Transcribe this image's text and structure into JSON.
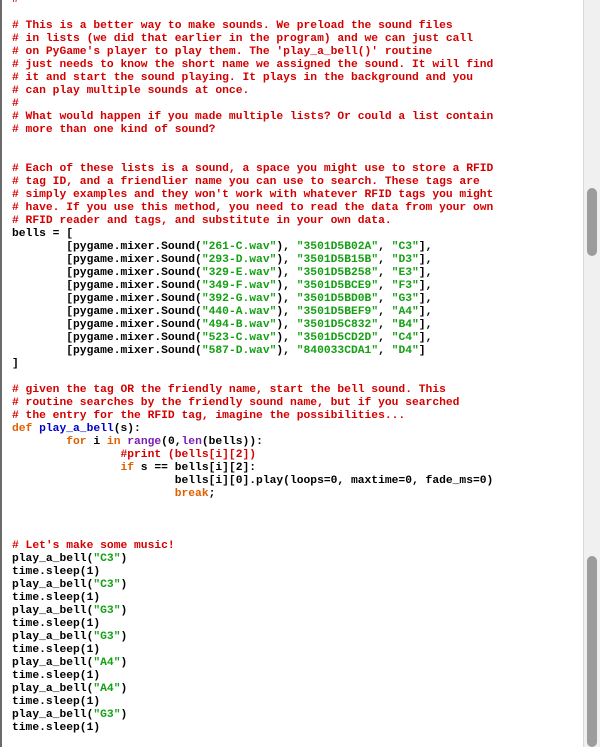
{
  "colors": {
    "comment": "#d40000",
    "string": "#14a014",
    "keyword": "#e06000",
    "builtin": "#7a1fb0",
    "function_name": "#0000c8",
    "text": "#000000"
  },
  "editor": {
    "lines": [
      [
        {
          "t": "cm",
          "v": "# ------------------------------------------------------------"
        }
      ],
      [],
      [
        {
          "t": "cm",
          "v": "# This is a better way to make sounds. We preload the sound files"
        }
      ],
      [
        {
          "t": "cm",
          "v": "# in lists (we did that earlier in the program) and we can just call"
        }
      ],
      [
        {
          "t": "cm",
          "v": "# on PyGame's player to play them. The 'play_a_bell()' routine"
        }
      ],
      [
        {
          "t": "cm",
          "v": "# just needs to know the short name we assigned the sound. It will find"
        }
      ],
      [
        {
          "t": "cm",
          "v": "# it and start the sound playing. It plays in the background and you"
        }
      ],
      [
        {
          "t": "cm",
          "v": "# can play multiple sounds at once."
        }
      ],
      [
        {
          "t": "cm",
          "v": "#"
        }
      ],
      [
        {
          "t": "cm",
          "v": "# What would happen if you made multiple lists? Or could a list contain"
        }
      ],
      [
        {
          "t": "cm",
          "v": "# more than one kind of sound?"
        }
      ],
      [],
      [],
      [
        {
          "t": "cm",
          "v": "# Each of these lists is a sound, a space you might use to store a RFID"
        }
      ],
      [
        {
          "t": "cm",
          "v": "# tag ID, and a friendlier name you can use to search. These tags are"
        }
      ],
      [
        {
          "t": "cm",
          "v": "# simply examples and they won't work with whatever RFID tags you might"
        }
      ],
      [
        {
          "t": "cm",
          "v": "# have. If you use this method, you need to read the data from your own"
        }
      ],
      [
        {
          "t": "cm",
          "v": "# RFID reader and tags, and substitute in your own data."
        }
      ],
      [
        {
          "t": "pl",
          "v": "bells = ["
        }
      ],
      [
        {
          "t": "pl",
          "v": "        [pygame.mixer.Sound("
        },
        {
          "t": "str",
          "v": "\"261-C.wav\""
        },
        {
          "t": "pl",
          "v": "), "
        },
        {
          "t": "str",
          "v": "\"3501D5B02A\""
        },
        {
          "t": "pl",
          "v": ", "
        },
        {
          "t": "str",
          "v": "\"C3\""
        },
        {
          "t": "pl",
          "v": "],"
        }
      ],
      [
        {
          "t": "pl",
          "v": "        [pygame.mixer.Sound("
        },
        {
          "t": "str",
          "v": "\"293-D.wav\""
        },
        {
          "t": "pl",
          "v": "), "
        },
        {
          "t": "str",
          "v": "\"3501D5B15B\""
        },
        {
          "t": "pl",
          "v": ", "
        },
        {
          "t": "str",
          "v": "\"D3\""
        },
        {
          "t": "pl",
          "v": "],"
        }
      ],
      [
        {
          "t": "pl",
          "v": "        [pygame.mixer.Sound("
        },
        {
          "t": "str",
          "v": "\"329-E.wav\""
        },
        {
          "t": "pl",
          "v": "), "
        },
        {
          "t": "str",
          "v": "\"3501D5B258\""
        },
        {
          "t": "pl",
          "v": ", "
        },
        {
          "t": "str",
          "v": "\"E3\""
        },
        {
          "t": "pl",
          "v": "],"
        }
      ],
      [
        {
          "t": "pl",
          "v": "        [pygame.mixer.Sound("
        },
        {
          "t": "str",
          "v": "\"349-F.wav\""
        },
        {
          "t": "pl",
          "v": "), "
        },
        {
          "t": "str",
          "v": "\"3501D5BCE9\""
        },
        {
          "t": "pl",
          "v": ", "
        },
        {
          "t": "str",
          "v": "\"F3\""
        },
        {
          "t": "pl",
          "v": "],"
        }
      ],
      [
        {
          "t": "pl",
          "v": "        [pygame.mixer.Sound("
        },
        {
          "t": "str",
          "v": "\"392-G.wav\""
        },
        {
          "t": "pl",
          "v": "), "
        },
        {
          "t": "str",
          "v": "\"3501D5BD0B\""
        },
        {
          "t": "pl",
          "v": ", "
        },
        {
          "t": "str",
          "v": "\"G3\""
        },
        {
          "t": "pl",
          "v": "],"
        }
      ],
      [
        {
          "t": "pl",
          "v": "        [pygame.mixer.Sound("
        },
        {
          "t": "str",
          "v": "\"440-A.wav\""
        },
        {
          "t": "pl",
          "v": "), "
        },
        {
          "t": "str",
          "v": "\"3501D5BEF9\""
        },
        {
          "t": "pl",
          "v": ", "
        },
        {
          "t": "str",
          "v": "\"A4\""
        },
        {
          "t": "pl",
          "v": "],"
        }
      ],
      [
        {
          "t": "pl",
          "v": "        [pygame.mixer.Sound("
        },
        {
          "t": "str",
          "v": "\"494-B.wav\""
        },
        {
          "t": "pl",
          "v": "), "
        },
        {
          "t": "str",
          "v": "\"3501D5C832\""
        },
        {
          "t": "pl",
          "v": ", "
        },
        {
          "t": "str",
          "v": "\"B4\""
        },
        {
          "t": "pl",
          "v": "],"
        }
      ],
      [
        {
          "t": "pl",
          "v": "        [pygame.mixer.Sound("
        },
        {
          "t": "str",
          "v": "\"523-C.wav\""
        },
        {
          "t": "pl",
          "v": "), "
        },
        {
          "t": "str",
          "v": "\"3501D5CD2D\""
        },
        {
          "t": "pl",
          "v": ", "
        },
        {
          "t": "str",
          "v": "\"C4\""
        },
        {
          "t": "pl",
          "v": "],"
        }
      ],
      [
        {
          "t": "pl",
          "v": "        [pygame.mixer.Sound("
        },
        {
          "t": "str",
          "v": "\"587-D.wav\""
        },
        {
          "t": "pl",
          "v": "), "
        },
        {
          "t": "str",
          "v": "\"840033CDA1\""
        },
        {
          "t": "pl",
          "v": ", "
        },
        {
          "t": "str",
          "v": "\"D4\""
        },
        {
          "t": "pl",
          "v": "]"
        }
      ],
      [
        {
          "t": "pl",
          "v": "]"
        }
      ],
      [],
      [
        {
          "t": "cm",
          "v": "# given the tag OR the friendly name, start the bell sound. This"
        }
      ],
      [
        {
          "t": "cm",
          "v": "# routine searches by the friendly sound name, but if you searched"
        }
      ],
      [
        {
          "t": "cm",
          "v": "# the entry for the RFID tag, imagine the possibilities..."
        }
      ],
      [
        {
          "t": "kw",
          "v": "def"
        },
        {
          "t": "pl",
          "v": " "
        },
        {
          "t": "fn",
          "v": "play_a_bell"
        },
        {
          "t": "pl",
          "v": "(s):"
        }
      ],
      [
        {
          "t": "pl",
          "v": "        "
        },
        {
          "t": "kw",
          "v": "for"
        },
        {
          "t": "pl",
          "v": " i "
        },
        {
          "t": "kw",
          "v": "in"
        },
        {
          "t": "pl",
          "v": " "
        },
        {
          "t": "bi",
          "v": "range"
        },
        {
          "t": "pl",
          "v": "(0,"
        },
        {
          "t": "bi",
          "v": "len"
        },
        {
          "t": "pl",
          "v": "(bells)):"
        }
      ],
      [
        {
          "t": "pl",
          "v": "                "
        },
        {
          "t": "cm",
          "v": "#print (bells[i][2])"
        }
      ],
      [
        {
          "t": "pl",
          "v": "                "
        },
        {
          "t": "kw",
          "v": "if"
        },
        {
          "t": "pl",
          "v": " s == bells[i][2]:"
        }
      ],
      [
        {
          "t": "pl",
          "v": "                        bells[i][0].play(loops=0, maxtime=0, fade_ms=0)"
        }
      ],
      [
        {
          "t": "pl",
          "v": "                        "
        },
        {
          "t": "kw",
          "v": "break"
        },
        {
          "t": "pl",
          "v": ";"
        }
      ],
      [],
      [],
      [],
      [
        {
          "t": "cm",
          "v": "# Let's make some music!"
        }
      ],
      [
        {
          "t": "pl",
          "v": "play_a_bell("
        },
        {
          "t": "str",
          "v": "\"C3\""
        },
        {
          "t": "pl",
          "v": ")"
        }
      ],
      [
        {
          "t": "pl",
          "v": "time.sleep(1)"
        }
      ],
      [
        {
          "t": "pl",
          "v": "play_a_bell("
        },
        {
          "t": "str",
          "v": "\"C3\""
        },
        {
          "t": "pl",
          "v": ")"
        }
      ],
      [
        {
          "t": "pl",
          "v": "time.sleep(1)"
        }
      ],
      [
        {
          "t": "pl",
          "v": "play_a_bell("
        },
        {
          "t": "str",
          "v": "\"G3\""
        },
        {
          "t": "pl",
          "v": ")"
        }
      ],
      [
        {
          "t": "pl",
          "v": "time.sleep(1)"
        }
      ],
      [
        {
          "t": "pl",
          "v": "play_a_bell("
        },
        {
          "t": "str",
          "v": "\"G3\""
        },
        {
          "t": "pl",
          "v": ")"
        }
      ],
      [
        {
          "t": "pl",
          "v": "time.sleep(1)"
        }
      ],
      [
        {
          "t": "pl",
          "v": "play_a_bell("
        },
        {
          "t": "str",
          "v": "\"A4\""
        },
        {
          "t": "pl",
          "v": ")"
        }
      ],
      [
        {
          "t": "pl",
          "v": "time.sleep(1)"
        }
      ],
      [
        {
          "t": "pl",
          "v": "play_a_bell("
        },
        {
          "t": "str",
          "v": "\"A4\""
        },
        {
          "t": "pl",
          "v": ")"
        }
      ],
      [
        {
          "t": "pl",
          "v": "time.sleep(1)"
        }
      ],
      [
        {
          "t": "pl",
          "v": "play_a_bell("
        },
        {
          "t": "str",
          "v": "\"G3\""
        },
        {
          "t": "pl",
          "v": ")"
        }
      ],
      [
        {
          "t": "pl",
          "v": "time.sleep(1)"
        }
      ]
    ]
  }
}
